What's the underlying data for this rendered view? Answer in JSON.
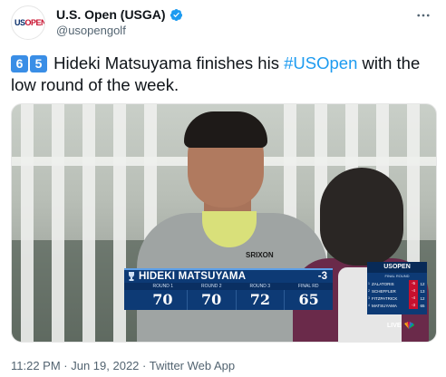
{
  "account": {
    "display_name": "U.S. Open (USGA)",
    "handle": "@usopengolf",
    "avatar_text_blue": "US",
    "avatar_text_red": "OPEN",
    "verified_icon": "verified-badge-icon",
    "more_icon": "more-options-icon"
  },
  "tweet": {
    "keycap_1": "6",
    "keycap_2": "5",
    "text_before": " Hideki Matsuyama finishes his ",
    "hashtag": "#USOpen",
    "text_after": " with the low round of the week."
  },
  "media": {
    "shirt_logo": "SRIXON",
    "lower_third": {
      "player_name": "HIDEKI MATSUYAMA",
      "score_to_par": "-3",
      "headers": [
        "ROUND 1",
        "ROUND 2",
        "ROUND 3",
        "FINAL RD"
      ],
      "values": [
        "70",
        "70",
        "72",
        "65"
      ]
    },
    "leaderboard": {
      "logo": "USOPEN",
      "title": "FINAL ROUND",
      "rows": [
        {
          "pos": "1",
          "name": "ZALATORIS",
          "to_par": "-5",
          "round": "12"
        },
        {
          "pos": "2",
          "name": "SCHEFFLER",
          "to_par": "-4",
          "round": "13"
        },
        {
          "pos": "3",
          "name": "FITZPATRICK",
          "to_par": "-4",
          "round": "12"
        },
        {
          "pos": "4",
          "name": "MATSUYAMA",
          "to_par": "-3",
          "round": "65"
        }
      ],
      "highlight_color": "#c8102e"
    },
    "live_label": "LIVE"
  },
  "meta": {
    "timestamp": "11:22 PM · Jun 19, 2022 · Twitter Web App"
  },
  "colors": {
    "link": "#1d9bf0",
    "keycap": "#3a8ee6",
    "broadcast_navy": "#0d3a75"
  }
}
